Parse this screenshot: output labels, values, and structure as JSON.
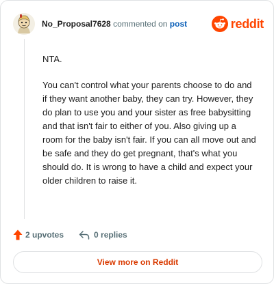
{
  "header": {
    "username": "No_Proposal7628",
    "action_text": "commented on",
    "post_link": "post",
    "brand": "reddit"
  },
  "comment": {
    "paragraphs": [
      "NTA.",
      "You can't control what your parents choose to do and if they want another baby, they can try. However, they do plan to use you and your sister as free babysitting and that isn't fair to either of you. Also giving up a room for the baby isn't fair. If you can all move out and be safe and they do get pregnant, that's what you should do. It is wrong to have a child and expect your older children to raise it."
    ]
  },
  "actions": {
    "upvotes_label": "2 upvotes",
    "replies_label": "0 replies"
  },
  "footer": {
    "view_more_label": "View more on Reddit"
  },
  "colors": {
    "brand_orange": "#ff4500",
    "upvote_arrow": "#ff4500",
    "link_blue": "#0a5fb8",
    "view_more_text": "#d93a00"
  },
  "icons": {
    "avatar": "cartoon-avatar",
    "logo": "reddit-snoo-icon",
    "upvote": "upvote-arrow-icon",
    "reply": "reply-arrow-icon"
  }
}
